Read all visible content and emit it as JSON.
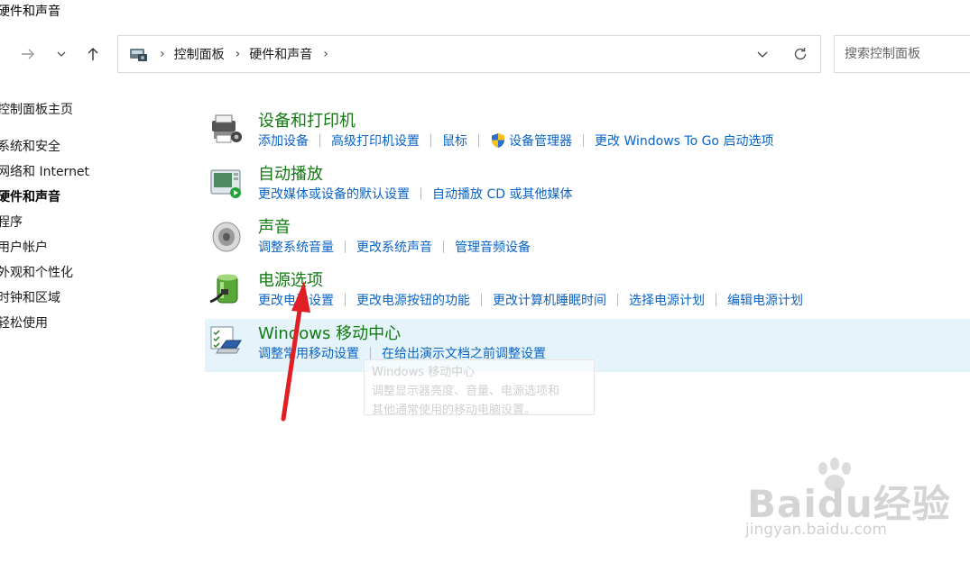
{
  "window": {
    "title": "硬件和声音"
  },
  "address": {
    "breadcrumbs": [
      "控制面板",
      "硬件和声音"
    ],
    "search_placeholder": "搜索控制面板"
  },
  "sidebar": {
    "items": [
      {
        "label": "控制面板主页"
      },
      {
        "label": "系统和安全"
      },
      {
        "label": "网络和 Internet"
      },
      {
        "label": "硬件和声音",
        "active": true
      },
      {
        "label": "程序"
      },
      {
        "label": "用户帐户"
      },
      {
        "label": "外观和个性化"
      },
      {
        "label": "时钟和区域"
      },
      {
        "label": "轻松使用"
      }
    ]
  },
  "categories": [
    {
      "title": "设备和打印机",
      "links": [
        "添加设备",
        "高级打印机设置",
        "鼠标",
        "设备管理器",
        "更改 Windows To Go 启动选项"
      ]
    },
    {
      "title": "自动播放",
      "links": [
        "更改媒体或设备的默认设置",
        "自动播放 CD 或其他媒体"
      ]
    },
    {
      "title": "声音",
      "links": [
        "调整系统音量",
        "更改系统声音",
        "管理音频设备"
      ]
    },
    {
      "title": "电源选项",
      "links": [
        "更改电池设置",
        "更改电源按钮的功能",
        "更改计算机睡眠时间",
        "选择电源计划",
        "编辑电源计划"
      ]
    },
    {
      "title": "Windows 移动中心",
      "links": [
        "调整常用移动设置",
        "在给出演示文档之前调整设置"
      ]
    }
  ],
  "tooltip": {
    "title": "Windows 移动中心",
    "line1": "调整显示器亮度、音量、电源选项和",
    "line2": "其他通常使用的移动电脑设置。"
  },
  "watermark": {
    "brand": "Baidu经验",
    "url": "jingyan.baidu.com"
  },
  "colors": {
    "category_title": "#117a11",
    "link": "#0a63c6",
    "highlight": "#e5f3fb",
    "arrow": "#e01e25"
  }
}
